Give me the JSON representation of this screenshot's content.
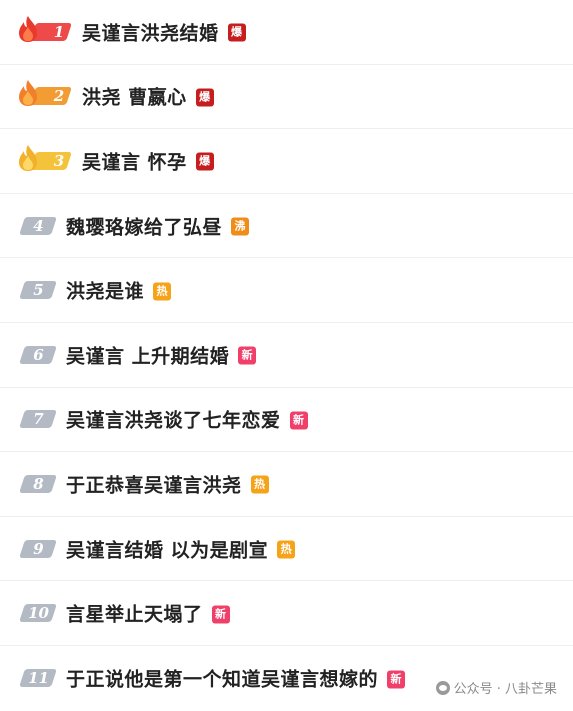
{
  "colors": {
    "rank_red": "#ee4a4a",
    "rank_orange": "#f39c33",
    "rank_yellow": "#f5c23c",
    "rank_gray": "#b4bac4",
    "badge_bao": "#c61e1e",
    "badge_fei": "#f08c1a",
    "badge_re": "#f6a31a",
    "badge_xin": "#f0406a"
  },
  "items": [
    {
      "rank": "1",
      "title": "吴谨言洪尧结婚",
      "badge": "爆",
      "rank_color": "#ee4a4a",
      "badge_color": "#c61e1e",
      "flame": "red"
    },
    {
      "rank": "2",
      "title": "洪尧 曹嬴心",
      "badge": "爆",
      "rank_color": "#f39c33",
      "badge_color": "#c61e1e",
      "flame": "orange"
    },
    {
      "rank": "3",
      "title": "吴谨言 怀孕",
      "badge": "爆",
      "rank_color": "#f5c23c",
      "badge_color": "#c61e1e",
      "flame": "yellow"
    },
    {
      "rank": "4",
      "title": "魏璎珞嫁给了弘昼",
      "badge": "沸",
      "rank_color": "#b4bac4",
      "badge_color": "#f08c1a"
    },
    {
      "rank": "5",
      "title": "洪尧是谁",
      "badge": "热",
      "rank_color": "#b4bac4",
      "badge_color": "#f6a31a"
    },
    {
      "rank": "6",
      "title": "吴谨言 上升期结婚",
      "badge": "新",
      "rank_color": "#b4bac4",
      "badge_color": "#f0406a"
    },
    {
      "rank": "7",
      "title": "吴谨言洪尧谈了七年恋爱",
      "badge": "新",
      "rank_color": "#b4bac4",
      "badge_color": "#f0406a"
    },
    {
      "rank": "8",
      "title": "于正恭喜吴谨言洪尧",
      "badge": "热",
      "rank_color": "#b4bac4",
      "badge_color": "#f6a31a"
    },
    {
      "rank": "9",
      "title": "吴谨言结婚 以为是剧宣",
      "badge": "热",
      "rank_color": "#b4bac4",
      "badge_color": "#f6a31a"
    },
    {
      "rank": "10",
      "title": "言星举止天塌了",
      "badge": "新",
      "rank_color": "#b4bac4",
      "badge_color": "#f0406a"
    },
    {
      "rank": "11",
      "title": "于正说他是第一个知道吴谨言想嫁的",
      "badge": "新",
      "rank_color": "#b4bac4",
      "badge_color": "#f0406a"
    }
  ],
  "watermark": {
    "icon": "wechat-icon",
    "text": "公众号 · 八卦芒果"
  }
}
